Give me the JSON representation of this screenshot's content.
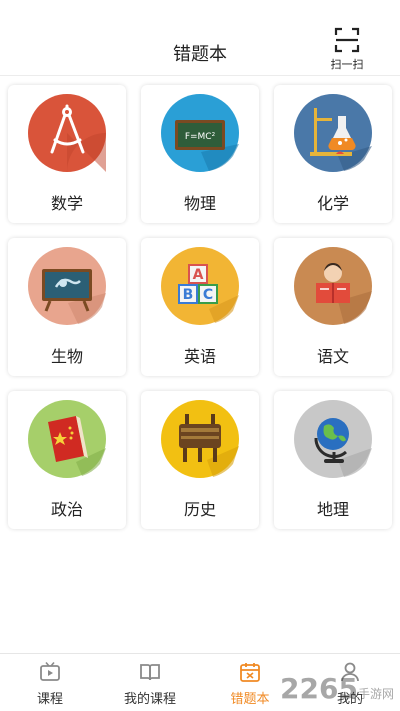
{
  "header": {
    "title": "错题本",
    "scan_label": "扫一扫"
  },
  "subjects": [
    {
      "label": "数学",
      "icon": "compass-icon",
      "color": "#d9543a"
    },
    {
      "label": "物理",
      "icon": "chalkboard-icon",
      "color": "#2a9fd6"
    },
    {
      "label": "化学",
      "icon": "flask-icon",
      "color": "#4a78a8"
    },
    {
      "label": "生物",
      "icon": "microscope-board-icon",
      "color": "#e8a58e"
    },
    {
      "label": "英语",
      "icon": "abc-blocks-icon",
      "color": "#f2b534"
    },
    {
      "label": "语文",
      "icon": "reading-icon",
      "color": "#c98a52"
    },
    {
      "label": "政治",
      "icon": "red-book-icon",
      "color": "#a6cf6a"
    },
    {
      "label": "历史",
      "icon": "bronze-vessel-icon",
      "color": "#f2c012"
    },
    {
      "label": "地理",
      "icon": "globe-icon",
      "color": "#b8b8b8"
    }
  ],
  "tabs": [
    {
      "label": "课程",
      "icon": "tv-icon",
      "active": false
    },
    {
      "label": "我的课程",
      "icon": "book-icon",
      "active": false
    },
    {
      "label": "错题本",
      "icon": "calendar-icon",
      "active": true
    },
    {
      "label": "我的",
      "icon": "user-icon",
      "active": false
    }
  ],
  "watermark": {
    "number": "2265",
    "text": "手游网"
  },
  "colors": {
    "accent": "#f08a24"
  }
}
